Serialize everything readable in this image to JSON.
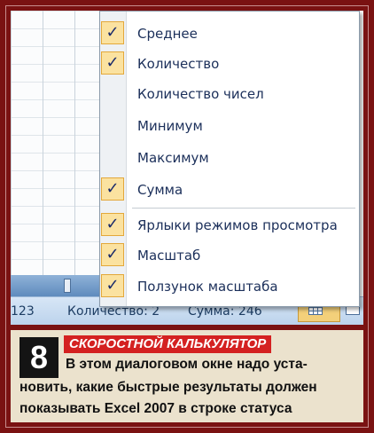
{
  "menu": {
    "items": [
      {
        "label": "Среднее",
        "checked": true
      },
      {
        "label": "Количество",
        "checked": true
      },
      {
        "label": "Количество чисел",
        "checked": false
      },
      {
        "label": "Минимум",
        "checked": false
      },
      {
        "label": "Максимум",
        "checked": false
      },
      {
        "label": "Сумма",
        "checked": true
      },
      {
        "label": "Ярлыки режимов просмотра",
        "checked": true
      },
      {
        "label": "Масштаб",
        "checked": true
      },
      {
        "label": "Ползунок масштаба",
        "checked": true
      }
    ],
    "check_glyph": "✓"
  },
  "statusbar": {
    "number": "123",
    "count": "Количество: 2",
    "sum": "Сумма: 246"
  },
  "caption": {
    "number": "8",
    "title": "СКОРОСТНОЙ КАЛЬКУЛЯТОР",
    "line1": "В этом диалоговом окне надо уста-",
    "line2": "новить, какие быстрые результаты должен",
    "line3": "показывать Excel 2007 в строке статуса"
  },
  "colors": {
    "background": "#7a1212",
    "check_bg": "#fbe2a0",
    "title_bg": "#d42121",
    "caption_bg": "#ebe2cd"
  }
}
